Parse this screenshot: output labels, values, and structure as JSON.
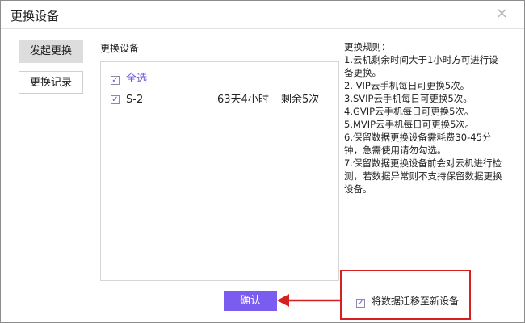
{
  "dialog": {
    "title": "更换设备",
    "close_glyph": "×"
  },
  "sidebar": {
    "items": [
      {
        "label": "发起更换"
      },
      {
        "label": "更换记录"
      }
    ]
  },
  "main": {
    "section_label": "更换设备",
    "select_all_label": "全选",
    "checkmark_glyph": "✓",
    "devices": [
      {
        "name": "S-2",
        "time_left": "63天4小时",
        "remaining": "剩余5次"
      }
    ]
  },
  "rules": {
    "lines": [
      "更换规则：",
      "1.云机剩余时间大于1小时方可进行设备更换。",
      "2. VIP云手机每日可更换5次。",
      "3.SVIP云手机每日可更换5次。",
      "4.GVIP云手机每日可更换5次。",
      "5.MVIP云手机每日可更换5次。",
      "6.保留数据更换设备需耗费30-45分钟，急需使用请勿勾选。",
      "7.保留数据更换设备前会对云机进行检测，若数据异常则不支持保留数据更换设备。"
    ]
  },
  "footer": {
    "confirm_label": "确认",
    "migrate_label": "将数据迁移至新设备"
  },
  "colors": {
    "accent": "#7b5cf0",
    "highlight_red": "#d42020"
  }
}
